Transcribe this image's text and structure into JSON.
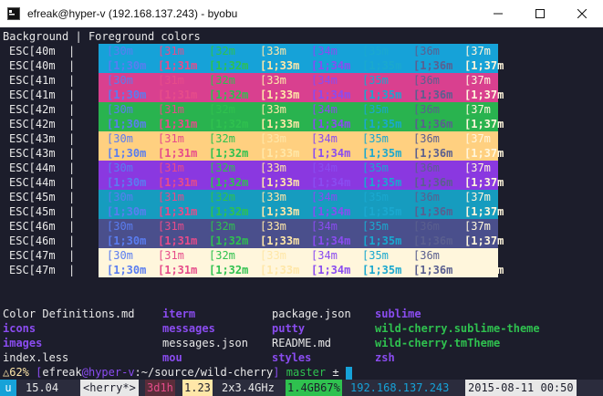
{
  "window": {
    "title": "efreak@hyper-v (192.168.137.243) - byobu",
    "minimize_icon": "minimize-icon",
    "maximize_icon": "maximize-icon",
    "close_icon": "close-icon"
  },
  "header": {
    "left": "Background",
    "separator": "|",
    "right": "Foreground colors"
  },
  "colors": {
    "bg_40": "#16a2d8",
    "bg_41": "#d9408f",
    "bg_42": "#29b34f",
    "bg_43": "#ffd080",
    "bg_44": "#8a38e0",
    "bg_45": "#169cbf",
    "bg_46": "#4a4f8c",
    "bg_47": "#fff6dc",
    "fg_30": "#5a7df0",
    "fg_31": "#e64c8a",
    "fg_32": "#2fc14f",
    "fg_33": "#ffe7a8",
    "fg_34": "#8a4cf0",
    "fg_35": "#1aa8cf",
    "fg_36": "#5a5f8f",
    "fg_37": "#fff6dc"
  },
  "rows": [
    {
      "label": "ESC[40m",
      "bg": "40",
      "bold": false
    },
    {
      "label": "ESC[40m",
      "bg": "40",
      "bold": true
    },
    {
      "label": "ESC[41m",
      "bg": "41",
      "bold": false
    },
    {
      "label": "ESC[41m",
      "bg": "41",
      "bold": true
    },
    {
      "label": "ESC[42m",
      "bg": "42",
      "bold": false
    },
    {
      "label": "ESC[42m",
      "bg": "42",
      "bold": true
    },
    {
      "label": "ESC[43m",
      "bg": "43",
      "bold": false
    },
    {
      "label": "ESC[43m",
      "bg": "43",
      "bold": true
    },
    {
      "label": "ESC[44m",
      "bg": "44",
      "bold": false
    },
    {
      "label": "ESC[44m",
      "bg": "44",
      "bold": true
    },
    {
      "label": "ESC[45m",
      "bg": "45",
      "bold": false
    },
    {
      "label": "ESC[45m",
      "bg": "45",
      "bold": true
    },
    {
      "label": "ESC[46m",
      "bg": "46",
      "bold": false
    },
    {
      "label": "ESC[46m",
      "bg": "46",
      "bold": true
    },
    {
      "label": "ESC[47m",
      "bg": "47",
      "bold": false
    },
    {
      "label": "ESC[47m",
      "bg": "47",
      "bold": true
    }
  ],
  "fg_codes": [
    "30",
    "31",
    "32",
    "33",
    "34",
    "35",
    "36",
    "37"
  ],
  "fg_labels_normal": [
    "[30m",
    "[31m",
    "[32m",
    "[33m",
    "[34m",
    "[35m",
    "[36m",
    "[37m"
  ],
  "fg_labels_bold": [
    "[1;30m",
    "[1;31m",
    "[1;32m",
    "[1;33m",
    "[1;34m",
    "[1;35m",
    "[1;36m",
    "[1;37m"
  ],
  "listing": {
    "col1": [
      "Color Definitions.md",
      "icons",
      "images",
      "index.less"
    ],
    "col2": [
      "iterm",
      "messages",
      "messages.json",
      "mou"
    ],
    "col3": [
      "package.json",
      "putty",
      "README.md",
      "styles"
    ],
    "col4": [
      "sublime",
      "wild-cherry.sublime-theme",
      "wild-cherry.tmTheme",
      "zsh"
    ]
  },
  "prompt": {
    "battery": "△62%",
    "user": "efreak",
    "host": "hyper-v",
    "path": "~/source/wild-cherry",
    "branch": "master",
    "status": "±"
  },
  "statusbar": {
    "os": "u",
    "version": "15.04",
    "session": "<herry*>",
    "uptime": "3d1h",
    "load": "1.23",
    "cpu": "2x3.4GHz",
    "mem": "1.4GB67%",
    "ip": "192.168.137.243",
    "datetime": "2015-08-11 00:50"
  }
}
